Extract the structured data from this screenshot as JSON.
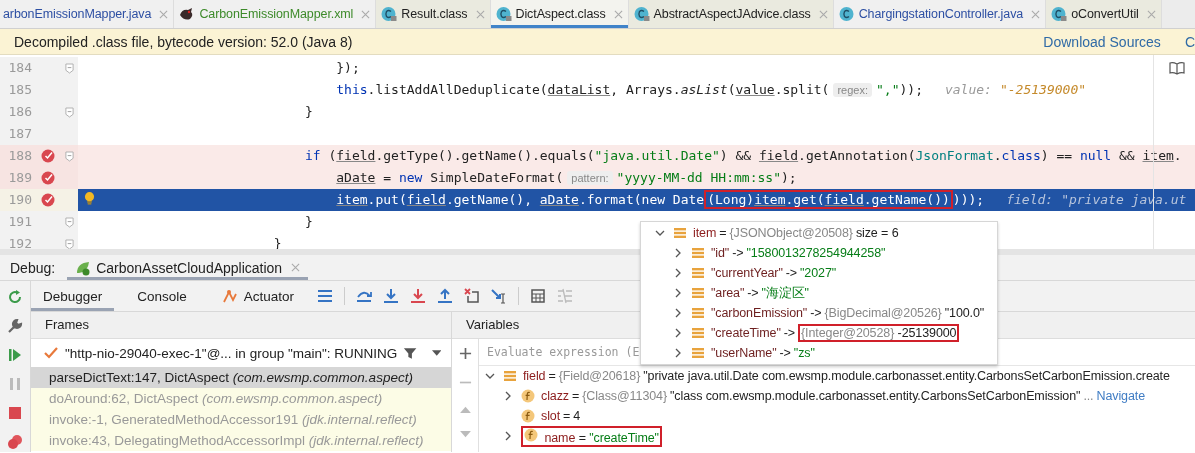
{
  "tabs": [
    {
      "label": "arbonEmissionMapper.java",
      "color": "#2d4fa3",
      "selected": false
    },
    {
      "label": "CarbonEmissionMapper.xml",
      "kind": "bird",
      "color": "#3d8a2a",
      "selected": false
    },
    {
      "label": "Result.class",
      "kind": "class-locked",
      "color": "#222222",
      "selected": false
    },
    {
      "label": "DictAspect.class",
      "kind": "class-locked",
      "color": "#222222",
      "selected": true
    },
    {
      "label": "AbstractAspectJAdvice.class",
      "kind": "class-locked",
      "color": "#222222",
      "selected": false
    },
    {
      "label": "ChargingstationController.java",
      "kind": "class",
      "color": "#2d4fa3",
      "selected": false
    },
    {
      "label": "oConvertUtil",
      "kind": "class-locked",
      "color": "#222222",
      "selected": false
    }
  ],
  "banner": {
    "message": "Decompiled .class file, bytecode version: 52.0 (Java 8)",
    "links": [
      "Download Sources",
      "C"
    ]
  },
  "code": [
    {
      "children": [
        {
          "children": [
            {
              "number": "184",
              "fold": true,
              "breakpoint": false,
              "current": false,
              "intention": false,
              "tokens": [
                {
                  "text": "});",
                  "kind": "plain"
                }
              ]
            },
            {
              "number": "185",
              "fold": false,
              "breakpoint": false,
              "current": false,
              "intention": false,
              "tokens": [
                {
                  "text": "this",
                  "kind": "kw"
                },
                {
                  "text": ".listAddAllDeduplicate(",
                  "kind": "plain"
                },
                {
                  "text": "dataList",
                  "kind": "var"
                },
                {
                  "text": ", Arrays.",
                  "kind": "plain"
                },
                {
                  "text": "asList",
                  "kind": "static"
                },
                {
                  "text": "(",
                  "kind": "plain"
                },
                {
                  "text": "value",
                  "kind": "var"
                },
                {
                  "text": ".split(",
                  "kind": "plain"
                },
                {
                  "text": "regex:",
                  "kind": "hint"
                },
                {
                  "text": "\",\"",
                  "kind": "str"
                },
                {
                  "text": "));",
                  "kind": "plain"
                },
                {
                  "text": "value:",
                  "kind": "valname"
                },
                {
                  "text": "\"-25139000\"",
                  "kind": "valstr"
                }
              ]
            }
          ]
        },
        {
          "number": "186",
          "fold": true,
          "breakpoint": false,
          "current": false,
          "intention": false,
          "tokens": [
            {
              "text": "}",
              "kind": "plain"
            }
          ]
        },
        {
          "number": "187",
          "fold": false,
          "breakpoint": false,
          "current": false,
          "intention": false
        },
        {
          "number": "188",
          "fold": true,
          "breakpoint": true,
          "current": false,
          "intention": false,
          "tokens": [
            {
              "text": "if",
              "kind": "kw"
            },
            {
              "text": " (",
              "kind": "plain"
            },
            {
              "text": "field",
              "kind": "var"
            },
            {
              "text": ".getType().getName().equals(",
              "kind": "plain"
            },
            {
              "text": "\"java.util.Date\"",
              "kind": "str"
            },
            {
              "text": ") && ",
              "kind": "plain"
            },
            {
              "text": "field",
              "kind": "var"
            },
            {
              "text": ".getAnnotation(",
              "kind": "plain"
            },
            {
              "text": "JsonFormat",
              "kind": "cls"
            },
            {
              "text": ".",
              "kind": "plain"
            },
            {
              "text": "class",
              "kind": "kw"
            },
            {
              "text": ") == ",
              "kind": "plain"
            },
            {
              "text": "null",
              "kind": "kw"
            },
            {
              "text": " && ",
              "kind": "plain"
            },
            {
              "text": "item",
              "kind": "var"
            },
            {
              "text": ".",
              "kind": "plain"
            }
          ]
        },
        {
          "children": [
            {
              "number": "189",
              "fold": false,
              "breakpoint": true,
              "current": false,
              "intention": false,
              "tokens": [
                {
                  "text": "aDate",
                  "kind": "var"
                },
                {
                  "text": " = ",
                  "kind": "plain"
                },
                {
                  "text": "new",
                  "kind": "kw"
                },
                {
                  "text": " SimpleDateFormat(",
                  "kind": "plain"
                },
                {
                  "text": "pattern:",
                  "kind": "hint"
                },
                {
                  "text": "\"yyyy-MM-dd HH:mm:ss\"",
                  "kind": "str"
                },
                {
                  "text": ");",
                  "kind": "plain"
                }
              ]
            },
            {
              "number": "190",
              "fold": false,
              "breakpoint": true,
              "current": true,
              "intention": true,
              "tokens": [
                {
                  "text": "item",
                  "kind": "var"
                },
                {
                  "text": ".put(",
                  "kind": "plain"
                },
                {
                  "text": "field",
                  "kind": "var"
                },
                {
                  "text": ".getName(), ",
                  "kind": "plain"
                },
                {
                  "text": "aDate",
                  "kind": "var"
                },
                {
                  "text": ".format(",
                  "kind": "plain"
                },
                {
                  "text": "new",
                  "kind": "kw"
                },
                {
                  "text": " Date",
                  "kind": "plain"
                },
                {
                  "kind": "marked",
                  "parts": [
                    {
                      "text": "(Long)",
                      "kind": "plain"
                    },
                    {
                      "text": "item",
                      "kind": "var"
                    },
                    {
                      "text": ".get(",
                      "kind": "plain"
                    },
                    {
                      "text": "field",
                      "kind": "var"
                    },
                    {
                      "text": ".getName())",
                      "kind": "plain"
                    }
                  ]
                },
                {
                  "text": ")));",
                  "kind": "plain"
                },
                {
                  "text": "field:",
                  "kind": "valname"
                },
                {
                  "text": "\"private java.ut",
                  "kind": "valstr"
                }
              ]
            }
          ]
        },
        {
          "number": "191",
          "fold": true,
          "breakpoint": false,
          "current": false,
          "intention": false,
          "tokens": [
            {
              "text": "}",
              "kind": "plain"
            }
          ]
        }
      ]
    },
    {
      "number": "192",
      "fold": true,
      "breakpoint": false,
      "current": false,
      "intention": false,
      "tokens": [
        {
          "text": "}",
          "kind": "plain"
        }
      ]
    }
  ],
  "debug": {
    "label": "Debug:",
    "session": "CarbonAssetCloudApplication",
    "tabs": [
      {
        "label": "Debugger",
        "selected": true
      },
      {
        "label": "Console",
        "selected": false
      },
      {
        "label": "Actuator",
        "kind": "actuator",
        "selected": false
      }
    ],
    "frames": {
      "title": "Frames",
      "thread": "\"http-nio-29040-exec-1\"@... in group \"main\": RUNNING",
      "items": [
        {
          "method": "parseDictText:147, DictAspect",
          "package": "(com.ewsmp.common.aspect)",
          "selected": true,
          "dimmed": false
        },
        {
          "method": "doAround:62, DictAspect",
          "package": "(com.ewsmp.common.aspect)",
          "selected": false,
          "dimmed": true
        },
        {
          "method": "invoke:-1, GeneratedMethodAccessor191",
          "package": "(jdk.internal.reflect)",
          "selected": false,
          "dimmed": true
        },
        {
          "method": "invoke:43, DelegatingMethodAccessorImpl",
          "package": "(jdk.internal.reflect)",
          "selected": false,
          "dimmed": true
        }
      ]
    },
    "variables": {
      "title": "Variables",
      "placeholder": "Evaluate expression (E",
      "tree": [
        {
          "name": "field",
          "separator": "=",
          "type": "{Field@20618}",
          "value": "\"private java.util.Date com.ewsmp.module.carbonasset.entity.CarbonsSetCarbonEmission.create",
          "is_string": false,
          "kind": "object",
          "expanded": true,
          "children": [
            {
              "name": "clazz",
              "separator": "=",
              "type": "{Class@11304}",
              "value": "\"class com.ewsmp.module.carbonasset.entity.CarbonsSetCarbonEmission\"",
              "is_string": false,
              "kind": "field",
              "expanded": false,
              "suffix": "...",
              "link": "Navigate"
            },
            {
              "name": "slot",
              "separator": "=",
              "value": "4",
              "is_string": false,
              "kind": "field"
            },
            {
              "name": "name",
              "separator": "=",
              "value": "\"createTime\"",
              "is_string": true,
              "kind": "field",
              "expanded": false,
              "marked": true
            }
          ]
        }
      ]
    },
    "popup": [
      {
        "name": "item",
        "separator": "=",
        "type": "{JSONObject@20508}",
        "value": "size = 6",
        "is_string": false,
        "kind": "object",
        "expanded": true,
        "children": [
          {
            "name": "\"id\"",
            "separator": "->",
            "value": "\"1580013278254944258\"",
            "is_string": true,
            "kind": "object",
            "expanded": false
          },
          {
            "name": "\"currentYear\"",
            "separator": "->",
            "value": "\"2027\"",
            "is_string": true,
            "kind": "object",
            "expanded": false
          },
          {
            "name": "\"area\"",
            "separator": "->",
            "value": "\"海淀区\"",
            "is_string": true,
            "kind": "object",
            "expanded": false
          },
          {
            "name": "\"carbonEmission\"",
            "separator": "->",
            "type": "{BigDecimal@20526}",
            "value": "\"100.0\"",
            "is_string": false,
            "kind": "object",
            "expanded": false
          },
          {
            "name": "\"createTime\"",
            "separator": "->",
            "type": "{Integer@20528}",
            "value": "-25139000",
            "is_string": false,
            "kind": "object",
            "expanded": false,
            "value_marked": true
          },
          {
            "name": "\"userName\"",
            "separator": "->",
            "value": "\"zs\"",
            "is_string": true,
            "kind": "object",
            "expanded": false
          }
        ]
      }
    ]
  }
}
